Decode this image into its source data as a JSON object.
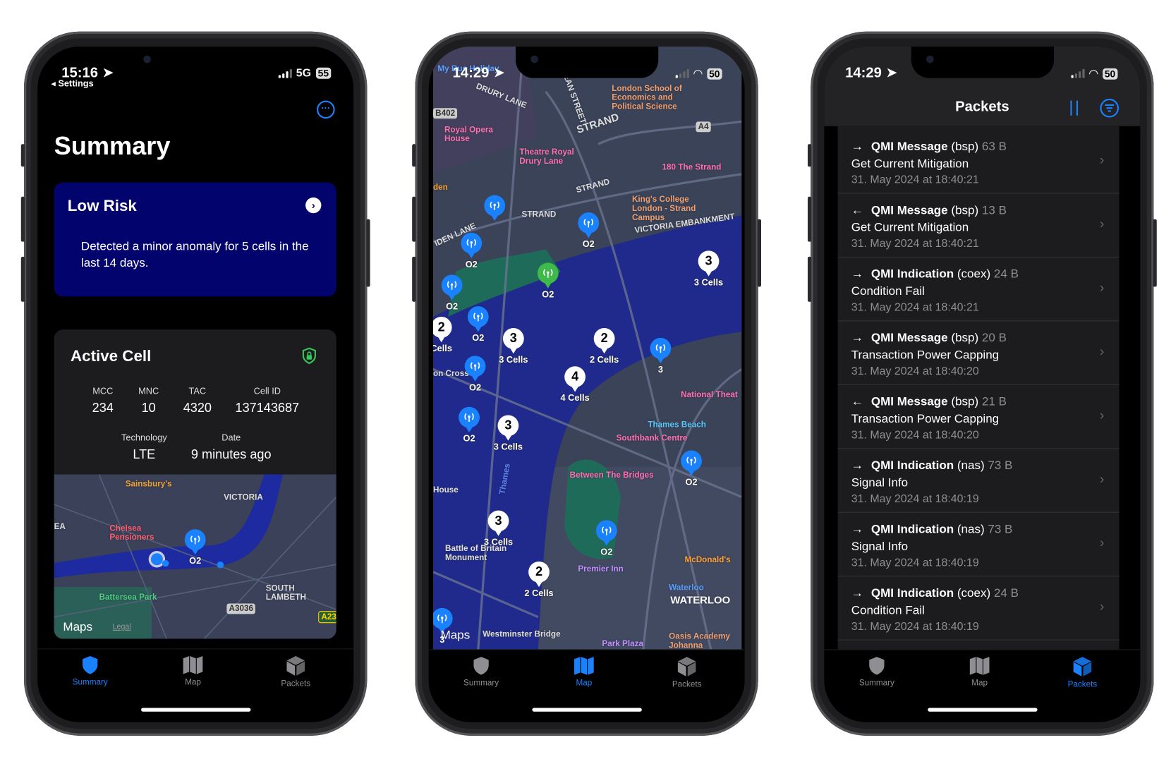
{
  "colors": {
    "accent": "#1a82ff",
    "low_risk_card": "#03036e",
    "card_bg": "#1c1c1e",
    "secure_green": "#34c759"
  },
  "tabs": [
    {
      "label": "Summary",
      "icon": "shield-icon"
    },
    {
      "label": "Map",
      "icon": "map-icon"
    },
    {
      "label": "Packets",
      "icon": "package-icon"
    }
  ],
  "summary_screen": {
    "status": {
      "time": "15:16",
      "back": "Settings",
      "network": "5G",
      "battery": "55"
    },
    "more_icon": "ellipsis-circle-icon",
    "title": "Summary",
    "risk": {
      "title": "Low Risk",
      "message": "Detected a minor anomaly for 5 cells in the last 14 days."
    },
    "active_cell": {
      "title": "Active Cell",
      "icon": "lock-shield-icon",
      "fields": [
        {
          "k": "MCC",
          "v": "234"
        },
        {
          "k": "MNC",
          "v": "10"
        },
        {
          "k": "TAC",
          "v": "4320"
        },
        {
          "k": "Cell ID",
          "v": "137143687"
        },
        {
          "k": "Technology",
          "v": "LTE"
        },
        {
          "k": "Date",
          "v": "9 minutes ago"
        }
      ],
      "map": {
        "labels": [
          "Sainsbury's",
          "VICTORIA",
          "EA",
          "Chelsea Pensioners",
          "Battersea Park",
          "SOUTH LAMBETH",
          "A3036",
          "A23"
        ],
        "pin_label": "O2",
        "attribution": "Maps",
        "legal": "Legal"
      }
    },
    "active_tab": 0
  },
  "map_screen": {
    "status": {
      "time": "14:29",
      "battery": "50"
    },
    "labels": [
      "My Bus Holiday",
      "DRURY LANE",
      "KEAN STREET",
      "London School of Economics and Political Science",
      "B402",
      "A4",
      "STRAND",
      "Royal Opera House",
      "Theatre Royal Drury Lane",
      "180 The Strand",
      "den",
      "STRAND",
      "King's College London - Strand Campus",
      "STRAND",
      "VICTORIA EMBANKMENT",
      "IDEN LANE",
      "National Theat",
      "Thames Beach",
      "Southbank Centre",
      "on Cross",
      "Between The Bridges",
      "House",
      "Thames",
      "Battle of Britain Monument",
      "Premier Inn",
      "McDonald's",
      "Waterloo",
      "WATERLOO",
      "Westminster Bridge",
      "Park Plaza",
      "Oasis Academy Johanna"
    ],
    "pins": [
      {
        "kind": "blue",
        "label": ""
      },
      {
        "kind": "blue",
        "label": "O2"
      },
      {
        "kind": "blue",
        "label": "O2"
      },
      {
        "kind": "blue",
        "label": "O2"
      },
      {
        "kind": "blue",
        "label": "O2"
      },
      {
        "kind": "blue",
        "label": "O2"
      },
      {
        "kind": "blue",
        "label": "O2"
      },
      {
        "kind": "blue",
        "label": "3"
      },
      {
        "kind": "blue",
        "label": "O2"
      },
      {
        "kind": "blue",
        "label": "O2"
      },
      {
        "kind": "blue",
        "label": "3"
      },
      {
        "kind": "green",
        "label": "O2"
      },
      {
        "kind": "white",
        "count": "3",
        "label": "3 Cells"
      },
      {
        "kind": "white",
        "count": "2",
        "label": "Cells"
      },
      {
        "kind": "white",
        "count": "3",
        "label": "3 Cells"
      },
      {
        "kind": "white",
        "count": "2",
        "label": "2 Cells"
      },
      {
        "kind": "white",
        "count": "4",
        "label": "4 Cells"
      },
      {
        "kind": "white",
        "count": "3",
        "label": "3 Cells"
      },
      {
        "kind": "white",
        "count": "3",
        "label": "3 Cells"
      },
      {
        "kind": "white",
        "count": "2",
        "label": "2 Cells"
      }
    ],
    "attribution": "Maps",
    "active_tab": 1
  },
  "packets_screen": {
    "status": {
      "time": "14:29",
      "battery": "50"
    },
    "title": "Packets",
    "pause_icon": "pause-icon",
    "filter_icon": "filter-circle-icon",
    "rows": [
      {
        "dir": "out",
        "type": "QMI Message",
        "svc": "(bsp)",
        "size": "63 B",
        "name": "Get Current Mitigation",
        "date": "31. May 2024 at 18:40:21"
      },
      {
        "dir": "in",
        "type": "QMI Message",
        "svc": "(bsp)",
        "size": "13 B",
        "name": "Get Current Mitigation",
        "date": "31. May 2024 at 18:40:21"
      },
      {
        "dir": "out",
        "type": "QMI Indication",
        "svc": "(coex)",
        "size": "24 B",
        "name": "Condition Fail",
        "date": "31. May 2024 at 18:40:21"
      },
      {
        "dir": "out",
        "type": "QMI Message",
        "svc": "(bsp)",
        "size": "20 B",
        "name": "Transaction Power Capping",
        "date": "31. May 2024 at 18:40:20"
      },
      {
        "dir": "in",
        "type": "QMI Message",
        "svc": "(bsp)",
        "size": "21 B",
        "name": "Transaction Power Capping",
        "date": "31. May 2024 at 18:40:20"
      },
      {
        "dir": "out",
        "type": "QMI Indication",
        "svc": "(nas)",
        "size": "73 B",
        "name": "Signal Info",
        "date": "31. May 2024 at 18:40:19"
      },
      {
        "dir": "out",
        "type": "QMI Indication",
        "svc": "(nas)",
        "size": "73 B",
        "name": "Signal Info",
        "date": "31. May 2024 at 18:40:19"
      },
      {
        "dir": "out",
        "type": "QMI Indication",
        "svc": "(coex)",
        "size": "24 B",
        "name": "Condition Fail",
        "date": "31. May 2024 at 18:40:19"
      }
    ],
    "active_tab": 2
  }
}
